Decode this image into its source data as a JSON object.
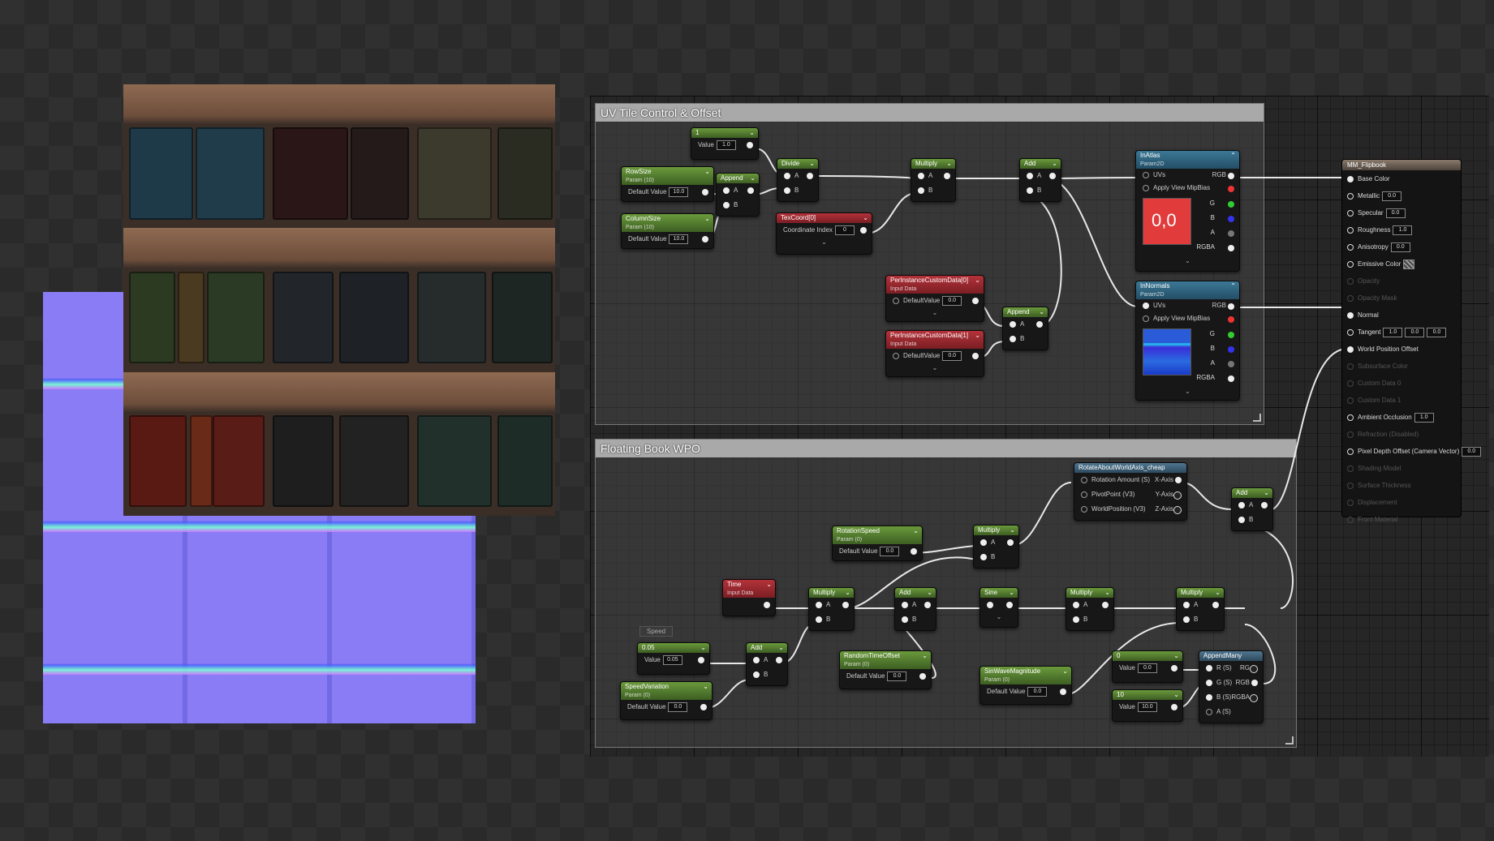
{
  "comments": {
    "uv": "UV Tile Control & Offset",
    "wpo": "Floating Book WPO"
  },
  "nodes": {
    "c1": {
      "title": "1",
      "value_label": "Value",
      "value": "1.0"
    },
    "rowsize": {
      "title": "RowSize",
      "sub": "Param (10)",
      "label": "Default Value",
      "value": "10.0"
    },
    "colsize": {
      "title": "ColumnSize",
      "sub": "Param (10)",
      "label": "Default Value",
      "value": "10.0"
    },
    "append1": {
      "title": "Append",
      "a": "A",
      "b": "B"
    },
    "divide": {
      "title": "Divide",
      "a": "A",
      "b": "B"
    },
    "texcoord": {
      "title": "TexCoord[0]",
      "label": "Coordinate Index",
      "value": "0"
    },
    "multiply1": {
      "title": "Multiply",
      "a": "A",
      "b": "B"
    },
    "add1": {
      "title": "Add",
      "a": "A",
      "b": "B"
    },
    "pic0": {
      "title": "PerInstanceCustomData[0]",
      "sub": "Input Data",
      "label": "DefaultValue",
      "value": "0.0"
    },
    "pic1": {
      "title": "PerInstanceCustomData[1]",
      "sub": "Input Data",
      "label": "DefaultValue",
      "value": "0.0"
    },
    "append2": {
      "title": "Append",
      "a": "A",
      "b": "B"
    },
    "inatlas": {
      "title": "InAtlas",
      "sub": "Param2D",
      "uvs": "UVs",
      "mip": "Apply View MipBias",
      "rgb": "RGB",
      "r": "R",
      "g": "G",
      "b": "B",
      "a": "A",
      "rgba": "RGBA",
      "preview": "0,0",
      "corner_tl": "0.0",
      "corner_br": "0.0"
    },
    "innormals": {
      "title": "InNormals",
      "sub": "Param2D",
      "uvs": "UVs",
      "mip": "Apply View MipBias",
      "rgb": "RGB",
      "r": "R",
      "g": "G",
      "b": "B",
      "a": "A",
      "rgba": "RGBA"
    },
    "rotate": {
      "title": "RotateAboutWorldAxis_cheap",
      "in1": "Rotation Amount (S)",
      "in2": "PivotPoint (V3)",
      "in3": "WorldPosition (V3)",
      "out1": "X-Axis",
      "out2": "Y-Axis",
      "out3": "Z-Axis"
    },
    "rotspeed": {
      "title": "RotationSpeed",
      "sub": "Param (0)",
      "label": "Default Value",
      "value": "0.0"
    },
    "multiply2": {
      "title": "Multiply",
      "a": "A",
      "b": "B"
    },
    "time": {
      "title": "Time",
      "sub": "Input Data"
    },
    "multiply3": {
      "title": "Multiply",
      "a": "A",
      "b": "B"
    },
    "add2": {
      "title": "Add",
      "a": "A",
      "b": "B"
    },
    "sine": {
      "title": "Sine"
    },
    "multiply4": {
      "title": "Multiply",
      "a": "A",
      "b": "B"
    },
    "multiply5": {
      "title": "Multiply",
      "a": "A",
      "b": "B"
    },
    "add3": {
      "title": "Add",
      "a": "A",
      "b": "B"
    },
    "c005": {
      "title": "0.05",
      "label": "Value",
      "value": "0.05"
    },
    "speedvar": {
      "title": "SpeedVariation",
      "sub": "Param (0)",
      "label": "Default Value",
      "value": "0.0"
    },
    "add4": {
      "title": "Add",
      "a": "A",
      "b": "B"
    },
    "randtime": {
      "title": "RandomTimeOffset",
      "sub": "Param (0)",
      "label": "Default Value",
      "value": "0.0"
    },
    "sinmag": {
      "title": "SinWaveMagnitude",
      "sub": "Param (0)",
      "label": "Default Value",
      "value": "0.0"
    },
    "c0": {
      "title": "0",
      "label": "Value",
      "value": "0.0"
    },
    "c10": {
      "title": "10",
      "label": "Value",
      "value": "10.0"
    },
    "appendmany": {
      "title": "AppendMany",
      "r": "R (S)",
      "g": "G (S)",
      "b": "B (S)",
      "a": "A (S)",
      "rg": "RG",
      "rgb": "RGB",
      "rgba": "RGBA"
    },
    "speed_comment": "Speed"
  },
  "main_node": {
    "title": "MM_Flipbook",
    "rows": [
      {
        "label": "Base Color",
        "active": true,
        "connected": true
      },
      {
        "label": "Metallic",
        "value": "0.0",
        "active": true
      },
      {
        "label": "Specular",
        "value": "0.0",
        "active": true
      },
      {
        "label": "Roughness",
        "value": "1.0",
        "active": true
      },
      {
        "label": "Anisotropy",
        "value": "0.0",
        "active": true
      },
      {
        "label": "Emissive Color",
        "swatch": true,
        "active": true
      },
      {
        "label": "Opacity",
        "active": false
      },
      {
        "label": "Opacity Mask",
        "active": false
      },
      {
        "label": "Normal",
        "active": true,
        "connected": true
      },
      {
        "label": "Tangent",
        "tangent": [
          "1.0",
          "0.0",
          "0.0"
        ],
        "active": true
      },
      {
        "label": "World Position Offset",
        "active": true,
        "connected": true
      },
      {
        "label": "Subsurface Color",
        "active": false
      },
      {
        "label": "Custom Data 0",
        "active": false
      },
      {
        "label": "Custom Data 1",
        "active": false
      },
      {
        "label": "Ambient Occlusion",
        "value": "1.0",
        "active": true
      },
      {
        "label": "Refraction (Disabled)",
        "active": false
      },
      {
        "label": "Pixel Depth Offset (Camera Vector)",
        "value": "0.0",
        "active": true
      },
      {
        "label": "Shading Model",
        "active": false
      },
      {
        "label": "Surface Thickness",
        "active": false
      },
      {
        "label": "Displacement",
        "active": false
      },
      {
        "label": "Front Material",
        "active": false
      }
    ]
  },
  "colors": {
    "green_header": "#4c7a2c",
    "red_header": "#9a2830",
    "blue_header": "#2f6682",
    "accent_red_preview": "#e23b3b"
  }
}
